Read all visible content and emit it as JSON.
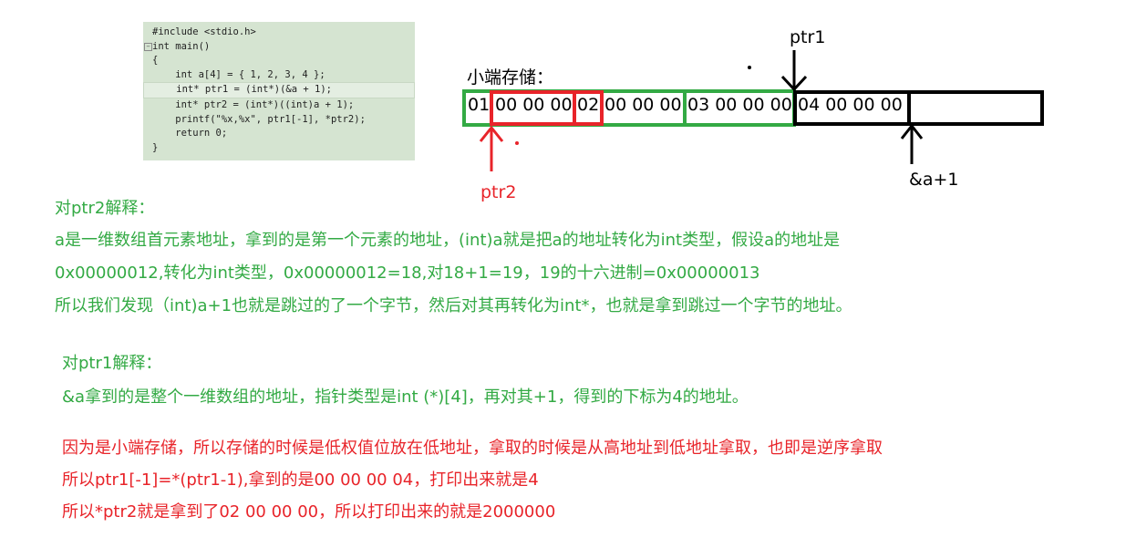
{
  "code": {
    "lines": [
      "#include <stdio.h>",
      "int main()",
      "{",
      "    int a[4] = { 1, 2, 3, 4 };",
      "    int* ptr1 = (int*)(&a + 1);",
      "    int* ptr2 = (int*)((int)a + 1);",
      "    printf(\"%x,%x\", ptr1[-1], *ptr2);",
      "    return 0;",
      "}"
    ]
  },
  "diagram": {
    "title": "小端存储：",
    "cells": [
      "01",
      "00 00 00",
      "02",
      "00 00 00",
      "03 00 00 00",
      "04 00 00 00"
    ],
    "labels": {
      "ptr1": "ptr1",
      "ptr2": "ptr2",
      "end": "&a+1"
    },
    "colors": {
      "green": "#33aa44",
      "red": "#e8242a",
      "black": "#000000"
    }
  },
  "explanation": {
    "ptr2_title": "对ptr2解释：",
    "ptr2_lines": [
      "a是一维数组首元素地址，拿到的是第一个元素的地址，(int)a就是把a的地址转化为int类型，假设a的地址是",
      "0x00000012,转化为int类型，0x00000012=18,对18+1=19，19的十六进制=0x00000013",
      "所以我们发现（int)a+1也就是跳过的了一个字节，然后对其再转化为int*，也就是拿到跳过一个字节的地址。"
    ],
    "ptr1_title": "对ptr1解释：",
    "ptr1_lines": [
      "&a拿到的是整个一维数组的地址，指针类型是int (*)[4]，再对其+1，得到的下标为4的地址。"
    ],
    "conclusion_lines": [
      "因为是小端存储，所以存储的时候是低权值位放在低地址，拿取的时候是从高地址到低地址拿取，也即是逆序拿取",
      "所以ptr1[-1]=*(ptr1-1),拿到的是00 00 00 04，打印出来就是4",
      "所以*ptr2就是拿到了02 00 00 00，所以打印出来的就是2000000"
    ]
  }
}
